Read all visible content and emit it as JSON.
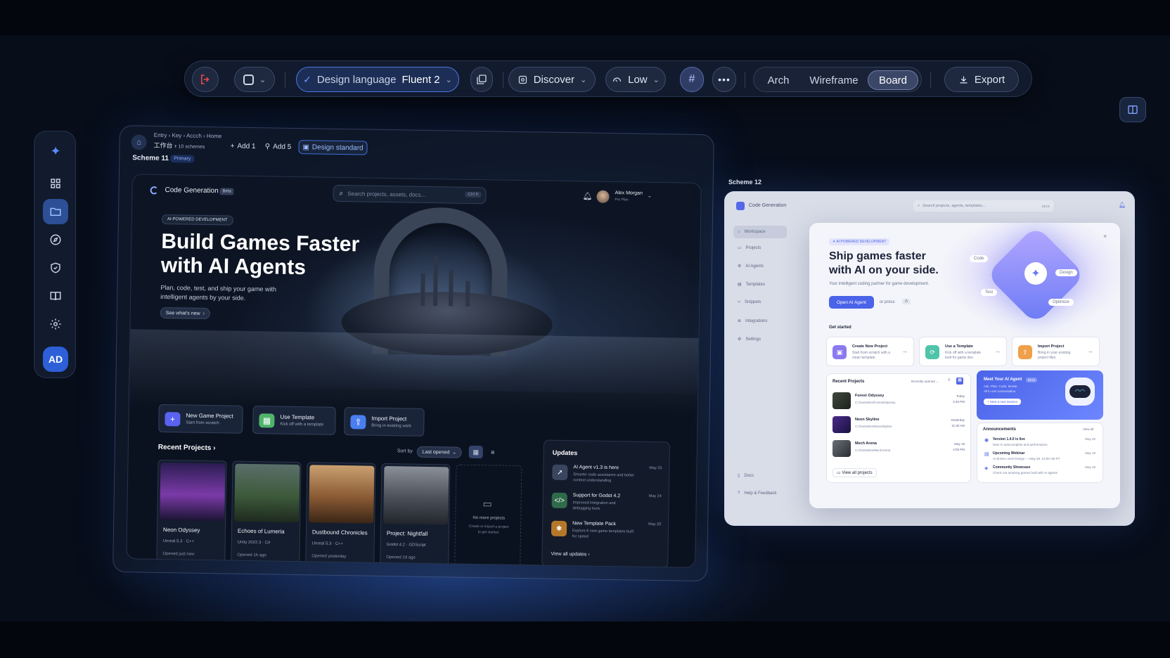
{
  "toolbar": {
    "design_language_label": "Design language",
    "design_language_value": "Fluent 2",
    "discover_label": "Discover",
    "level_label": "Low",
    "view_modes": [
      "Arch",
      "Wireframe",
      "Board"
    ],
    "active_view": "Board",
    "export_label": "Export"
  },
  "rail": {
    "avatar_initials": "AD"
  },
  "scheme11": {
    "breadcrumb": [
      "Entry",
      "Key",
      "Accch",
      "Home"
    ],
    "workspace": "工作台",
    "schemes_count": "10 schemes",
    "add1_label": "Add 1",
    "add5_label": "Add 5",
    "design_standard_label": "Design standard",
    "scheme_label": "Scheme 11",
    "primary_tag": "Primary",
    "app": {
      "title": "Code Generation",
      "beta": "Beta",
      "search_placeholder": "Search projects, assets, docs...",
      "search_shortcut": "Ctrl K",
      "user_name": "Alex Morgan",
      "user_plan": "Pro Plan",
      "eyebrow": "AI-POWERED DEVELOPMENT",
      "headline_1": "Build Games Faster",
      "headline_2": "with AI Agents",
      "subtext_1": "Plan, code, test, and ship your game with",
      "subtext_2": "intelligent agents by your side.",
      "see_whats_new": "See what's new",
      "actions": [
        {
          "title": "New Game Project",
          "desc": "Start from scratch",
          "color": "#5a63f0"
        },
        {
          "title": "Use Template",
          "desc": "Kick off with a template",
          "color": "#4fb46a"
        },
        {
          "title": "Import Project",
          "desc": "Bring in existing work",
          "color": "#4a7ef0"
        }
      ],
      "recent_title": "Recent Projects",
      "sort_by_label": "Sort by",
      "sort_value": "Last opened",
      "projects": [
        {
          "name": "Neon Odyssey",
          "engine": "Unreal 5.3",
          "lang": "C++",
          "opened": "Opened just now"
        },
        {
          "name": "Echoes of Lumeria",
          "engine": "Unity 2022.3",
          "lang": "C#",
          "opened": "Opened 1h ago"
        },
        {
          "name": "Dustbound Chronicles",
          "engine": "Unreal 5.3",
          "lang": "C++",
          "opened": "Opened yesterday"
        },
        {
          "name": "Project: Nightfall",
          "engine": "Godot 4.2",
          "lang": "GDScript",
          "opened": "Opened 2d ago"
        }
      ],
      "empty_title": "No more projects",
      "empty_desc_1": "Create or import a project",
      "empty_desc_2": "to get started.",
      "updates_title": "Updates",
      "updates": [
        {
          "title": "AI Agent v1.3 is here",
          "desc": "Smarter code assistance and better context understanding",
          "date": "May 25",
          "color": "#3a4560",
          "icon": "rocket"
        },
        {
          "title": "Support for Godot 4.2",
          "desc": "Improved integration and debugging tools",
          "date": "May 24",
          "color": "#2f6b4a",
          "icon": "code"
        },
        {
          "title": "New Template Pack",
          "desc": "Explore 6 new game templates built for speed",
          "date": "May 20",
          "color": "#b5782a",
          "icon": "puzzle"
        }
      ],
      "view_all_updates": "View all updates"
    }
  },
  "scheme12": {
    "scheme_label": "Scheme 12",
    "app_title": "Code Generation",
    "search_placeholder": "Search projects, agents, templates...",
    "search_shortcut": "Ctrl K",
    "nav": [
      "Workspace",
      "Projects",
      "AI Agents",
      "Templates",
      "Snippets",
      "Integrations",
      "Settings"
    ],
    "nav_bottom": [
      "Docs",
      "Help & Feedback"
    ],
    "modal": {
      "eyebrow": "AI POWERED DEVELOPMENT",
      "headline_1": "Ship games faster",
      "headline_2": "with AI on your side.",
      "subtext": "Your intelligent coding partner for game development.",
      "primary_btn": "Open AI Agent",
      "or_press": "or press",
      "key": "A",
      "floating_labels": [
        "Code",
        "Design",
        "Test",
        "Optimize"
      ],
      "get_started": "Get started",
      "start_cards": [
        {
          "title": "Create New Project",
          "desc": "Start from scratch with a clean template.",
          "color": "#8a7af0"
        },
        {
          "title": "Use a Template",
          "desc": "Kick off with a template built for game dev.",
          "color": "#4fc4a8"
        },
        {
          "title": "Import Project",
          "desc": "Bring in your existing project files.",
          "color": "#f0a04a"
        }
      ],
      "recent_title": "Recent Projects",
      "recent_sort": "Recently opened",
      "recent": [
        {
          "name": "Forest Odyssey",
          "path": "C:/GameDev/ForestOdyssey",
          "day": "Today",
          "time": "2:45 PM"
        },
        {
          "name": "Neon Skyline",
          "path": "C:/GameDev/NeonSkyline",
          "day": "Yesterday",
          "time": "11:30 AM"
        },
        {
          "name": "Mech Arena",
          "path": "C:/GameDev/MechArena",
          "day": "May 18",
          "time": "4:05 PM"
        }
      ],
      "view_all_projects": "View all projects",
      "agent_title": "Meet Your AI Agent",
      "agent_badge": "BETA",
      "agent_desc_1": "Ask. Plan. Code. Iterate.",
      "agent_desc_2": "All in one conversation.",
      "agent_btn": "Start a new session",
      "announcements_title": "Announcements",
      "announcements_viewall": "View all",
      "announcements": [
        {
          "title": "Version 1.4.0 is live",
          "desc": "New AI autocomplete and performance",
          "date": "May 20"
        },
        {
          "title": "Upcoming Webinar",
          "desc": "AI-driven Level Design — May 28, 10:00 AM PT",
          "date": "May 19"
        },
        {
          "title": "Community Showcase",
          "desc": "Check out amazing games built with AI agents",
          "date": "May 18"
        }
      ]
    }
  }
}
